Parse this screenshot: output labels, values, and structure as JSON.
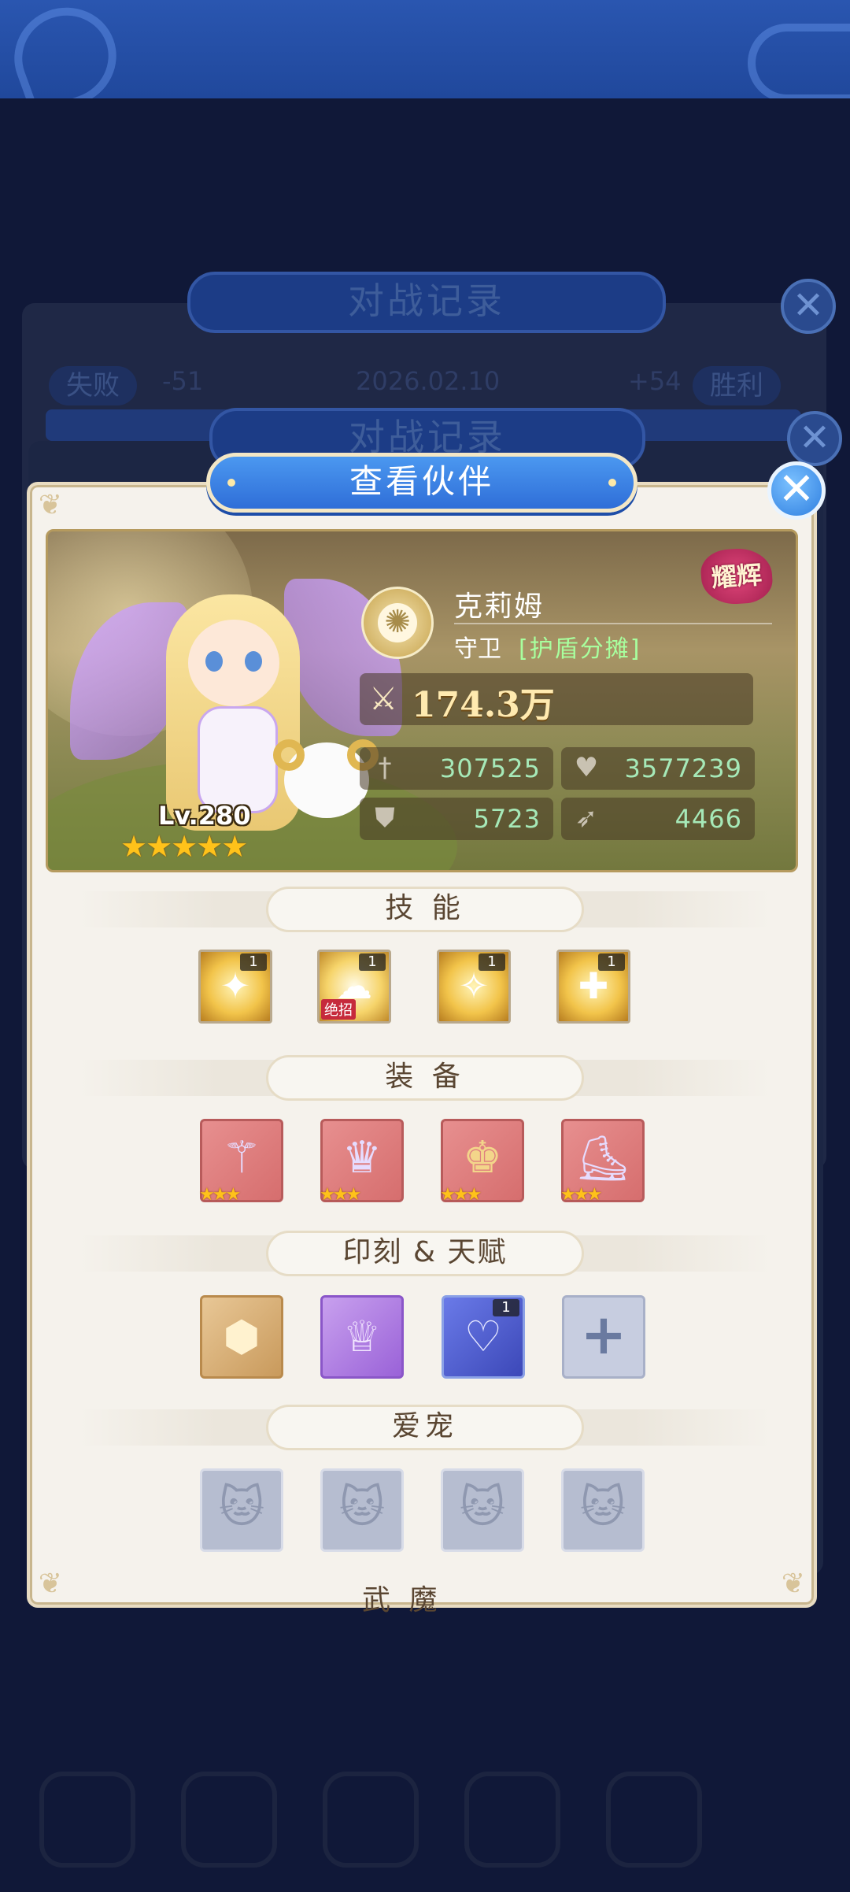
{
  "background": {
    "banner_1": "对战记录",
    "banner_2": "对战记录",
    "record": {
      "lose_label": "失败",
      "lose_delta": "-51",
      "date": "2026.02.10",
      "win_delta": "+54",
      "win_label": "胜利"
    },
    "close_label": "✕"
  },
  "modal": {
    "title": "查看伙伴",
    "close_label": "✕"
  },
  "hero": {
    "name": "克莉姆",
    "role": "守卫",
    "tag": "[护盾分摊]",
    "badge": "耀辉",
    "level": "Lv.280",
    "stars": "★★★★★",
    "power": "174.3万",
    "stats": {
      "attack": "307525",
      "hp": "3577239",
      "defense": "5723",
      "speed": "4466"
    }
  },
  "sections": {
    "skills": "技 能",
    "equipment": "装 备",
    "runes": "印刻 & 天赋",
    "pets": "爱宠",
    "next_partial": "武 魔"
  },
  "skills": [
    {
      "level": "1",
      "icon": "fairy-skill-icon"
    },
    {
      "level": "1",
      "icon": "sheep-skill-icon",
      "tag": "绝招"
    },
    {
      "level": "1",
      "icon": "light-skill-icon"
    },
    {
      "level": "1",
      "icon": "cross-skill-icon"
    }
  ],
  "equipment": [
    {
      "icon": "staff-icon",
      "stars": "★★★"
    },
    {
      "icon": "armor-icon",
      "stars": "★★★"
    },
    {
      "icon": "crown-helm-icon",
      "stars": "★★★"
    },
    {
      "icon": "boot-icon",
      "stars": "★★★"
    }
  ],
  "runes": [
    {
      "icon": "gold-rune-icon"
    },
    {
      "icon": "purple-crown-rune-icon"
    },
    {
      "icon": "heart-talent-icon",
      "level": "1"
    },
    {
      "icon": "add-icon",
      "label": "+"
    }
  ],
  "pets": [
    {
      "icon": "cat-silhouette-icon"
    },
    {
      "icon": "cat-silhouette-icon"
    },
    {
      "icon": "cat-silhouette-icon"
    },
    {
      "icon": "cat-silhouette-icon"
    }
  ],
  "colors": {
    "accent_blue": "#2f6ed8",
    "panel": "#f5f2ec",
    "stat_green": "#a6e9b8",
    "star": "#ffc21a"
  }
}
